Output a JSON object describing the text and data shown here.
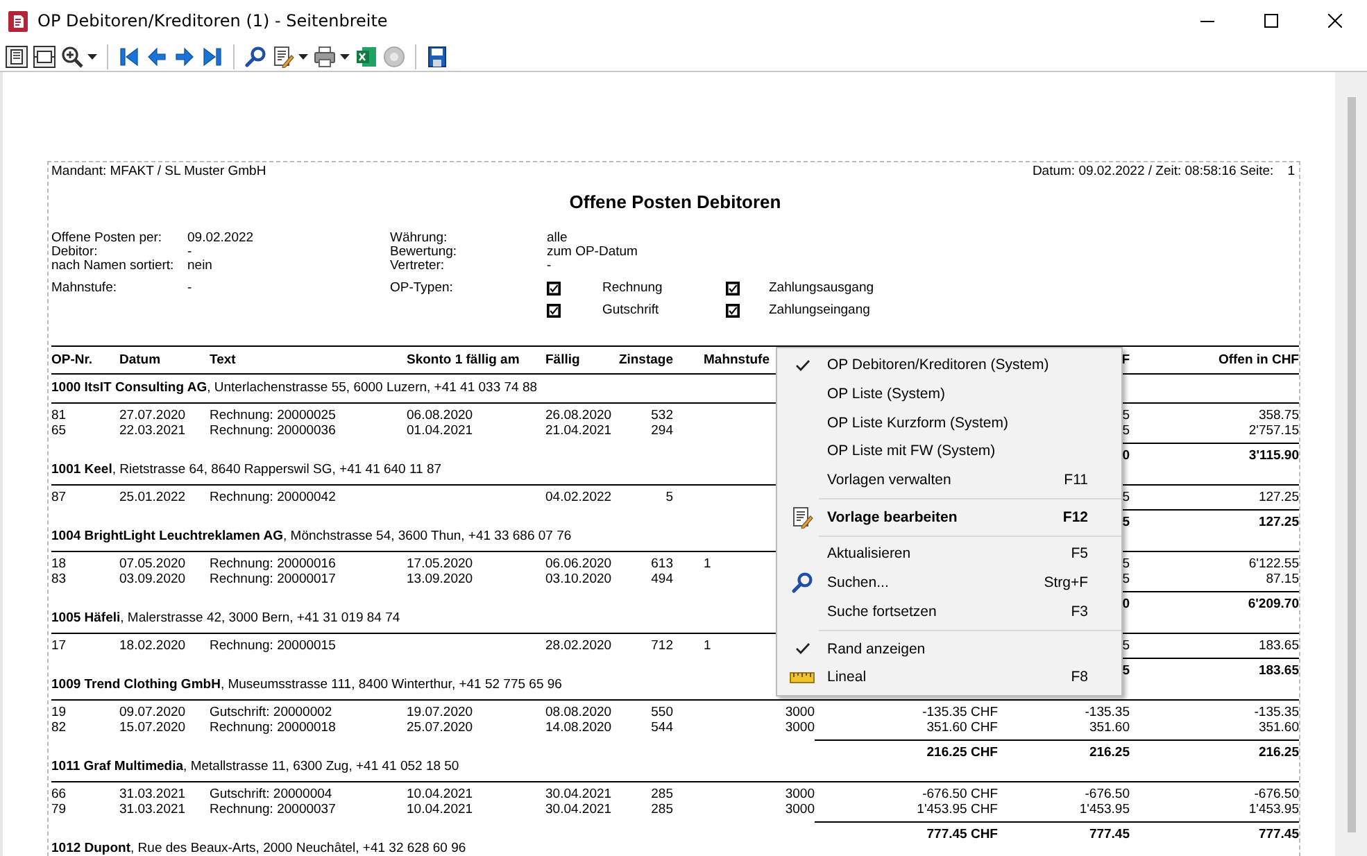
{
  "window": {
    "title": "OP Debitoren/Kreditoren (1) - Seitenbreite"
  },
  "report": {
    "client": "Mandant: MFAKT / SL Muster GmbH",
    "stamp": "Datum: 09.02.2022 / Zeit: 08:58:16 Seite:",
    "page": "1",
    "title": "Offene Posten Debitoren",
    "params_left": [
      {
        "label": "Offene Posten per:",
        "value": "09.02.2022"
      },
      {
        "label": "Debitor:",
        "value": "-"
      },
      {
        "label": "nach Namen sortiert:",
        "value": "nein"
      },
      {
        "label": "Mahnstufe:",
        "value": "-"
      }
    ],
    "params_right": [
      {
        "label": "Währung:",
        "value": "alle"
      },
      {
        "label": "Bewertung:",
        "value": "zum OP-Datum"
      },
      {
        "label": "Vertreter:",
        "value": "-"
      }
    ],
    "op_types": {
      "label": "OP-Typen:",
      "types": [
        {
          "label": "Rechnung",
          "checked": true
        },
        {
          "label": "Zahlungsausgang",
          "checked": true
        },
        {
          "label": "Gutschrift",
          "checked": true
        },
        {
          "label": "Zahlungseingang",
          "checked": true
        }
      ]
    },
    "table": {
      "columns": [
        "OP-Nr.",
        "Datum",
        "Text",
        "Skonto 1 fällig am",
        "Fällig",
        "Zinstage",
        "Mahnstufe",
        null,
        null,
        "F",
        "Offen in CHF"
      ],
      "groups": [
        {
          "header": "**1000 ItsIT Consulting AG**, Unterlachenstrasse 55, 6000 Luzern, +41 41 033 74 88",
          "rows": [
            [
              "81",
              "27.07.2020",
              "Rechnung: 20000025",
              "06.08.2020",
              "26.08.2020",
              "532",
              null,
              null,
              null,
              "5",
              "358.75"
            ],
            [
              "65",
              "22.03.2021",
              "Rechnung: 20000036",
              "01.04.2021",
              "21.04.2021",
              "294",
              null,
              null,
              null,
              "5",
              "2'757.15"
            ]
          ],
          "total": [
            "0",
            "3'115.90"
          ]
        },
        {
          "header": "**1001 Keel**, Rietstrasse 64, 8640 Rapperswil SG, +41 41 640 11 87",
          "rows": [
            [
              "87",
              "25.01.2022",
              "Rechnung: 20000042",
              null,
              "04.02.2022",
              "5",
              null,
              null,
              null,
              "5",
              "127.25"
            ]
          ],
          "total": [
            "5",
            "127.25"
          ]
        },
        {
          "header": "**1004 BrightLight Leuchtreklamen AG**, Mönchstrasse 54, 3600 Thun, +41 33 686 07 76",
          "rows": [
            [
              "18",
              "07.05.2020",
              "Rechnung: 20000016",
              "17.05.2020",
              "06.06.2020",
              "613",
              "1",
              null,
              null,
              "5",
              "6'122.55"
            ],
            [
              "83",
              "03.09.2020",
              "Rechnung: 20000017",
              "13.09.2020",
              "03.10.2020",
              "494",
              null,
              null,
              null,
              "5",
              "87.15"
            ]
          ],
          "total": [
            "0",
            "6'209.70"
          ]
        },
        {
          "header": "**1005 Häfeli**, Malerstrasse 42, 3000 Bern, +41 31 019 84 74",
          "rows": [
            [
              "17",
              "18.02.2020",
              "Rechnung: 20000015",
              null,
              "28.02.2020",
              "712",
              "1",
              null,
              null,
              "5",
              "183.65"
            ]
          ],
          "total": [
            "5",
            "183.65"
          ]
        },
        {
          "header": "**1009 Trend Clothing GmbH**, Museumsstrasse 111, 8400 Winterthur, +41 52 775 65 96",
          "rows": [
            [
              "19",
              "09.07.2020",
              "Gutschrift: 20000002",
              "19.07.2020",
              "08.08.2020",
              "550",
              null,
              "3000",
              "-135.35 CHF",
              "-135.35",
              "-135.35"
            ],
            [
              "82",
              "15.07.2020",
              "Rechnung: 20000018",
              "25.07.2020",
              "14.08.2020",
              "544",
              null,
              "3000",
              "351.60 CHF",
              "351.60",
              "351.60"
            ]
          ],
          "total": [
            "216.25 CHF",
            "216.25",
            "216.25"
          ]
        },
        {
          "header": "**1011 Graf Multimedia**, Metallstrasse 11, 6300 Zug, +41 41 052 18 50",
          "rows": [
            [
              "66",
              "31.03.2021",
              "Gutschrift: 20000004",
              "10.04.2021",
              "30.04.2021",
              "285",
              null,
              "3000",
              "-676.50 CHF",
              "-676.50",
              "-676.50"
            ],
            [
              "79",
              "31.03.2021",
              "Rechnung: 20000037",
              "10.04.2021",
              "30.04.2021",
              "285",
              null,
              "3000",
              "1'453.95 CHF",
              "1'453.95",
              "1'453.95"
            ]
          ],
          "total": [
            "777.45 CHF",
            "777.45",
            "777.45"
          ]
        },
        {
          "header": "**1012 Dupont**, Rue des Beaux-Arts, 2000 Neuchâtel, +41 32 628 60 96"
        }
      ]
    }
  },
  "menu": {
    "items": [
      {
        "kind": "item",
        "label": "OP Debitoren/Kreditoren (System)",
        "checked": true,
        "default": false
      },
      {
        "kind": "item",
        "label": "OP Liste (System)",
        "checked": false,
        "default": false
      },
      {
        "kind": "item",
        "label": "OP Liste Kurzform (System)",
        "checked": false,
        "default": false
      },
      {
        "kind": "item",
        "label": "OP Liste mit FW (System)",
        "checked": false,
        "default": false
      },
      {
        "kind": "item",
        "label": "Vorlagen verwalten",
        "shortcut": "F11",
        "checked": false,
        "default": false
      },
      {
        "kind": "separator"
      },
      {
        "kind": "item",
        "label": "Vorlage bearbeiten",
        "shortcut": "F12",
        "checked": false,
        "default": true
      },
      {
        "kind": "separator"
      },
      {
        "kind": "item",
        "label": "Aktualisieren",
        "shortcut": "F5",
        "checked": false,
        "default": false
      },
      {
        "kind": "item",
        "label": "Suchen...",
        "shortcut": "Strg+F",
        "checked": false,
        "default": false
      },
      {
        "kind": "item",
        "label": "Suche fortsetzen",
        "shortcut": "F3",
        "checked": false,
        "default": false
      },
      {
        "kind": "separator"
      },
      {
        "kind": "item",
        "label": "Rand anzeigen",
        "checked": true,
        "default": false
      },
      {
        "kind": "item",
        "label": "Lineal",
        "shortcut": "F8",
        "checked": false,
        "default": false
      }
    ]
  }
}
